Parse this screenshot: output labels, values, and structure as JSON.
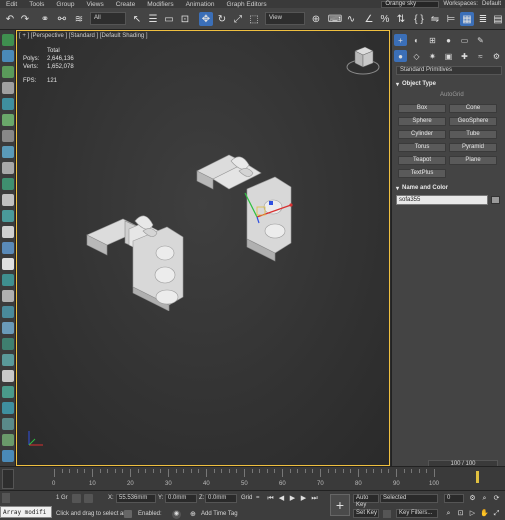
{
  "menubar": {
    "items": [
      "Edit",
      "Tools",
      "Group",
      "Views",
      "Create",
      "Modifiers",
      "Animation",
      "Graph Editors"
    ],
    "scene_name": "Orange sky",
    "workspaces_label": "Workspaces:",
    "workspace_value": "Default"
  },
  "toolbar": {
    "filter_value": "All",
    "coord_value": "View"
  },
  "viewport": {
    "label": "[ + ] [Perspective ] [Standard ] [Default Shading ]",
    "stats": {
      "total_label": "Total",
      "polys_label": "Polys:",
      "polys_value": "2,646,136",
      "verts_label": "Verts:",
      "verts_value": "1,652,078",
      "fps_label": "FPS:",
      "fps_value": "121"
    }
  },
  "command_panel": {
    "category_value": "Standard Primitives",
    "object_type_header": "Object Type",
    "autogrid_label": "AutoGrid",
    "primitives": [
      "Box",
      "Cone",
      "Sphere",
      "GeoSphere",
      "Cylinder",
      "Tube",
      "Torus",
      "Pyramid",
      "Teapot",
      "Plane",
      "TextPlus"
    ],
    "name_color_header": "Name and Color",
    "object_name": "sofa355",
    "object_color": "#9a9a9a"
  },
  "timeline": {
    "frame_display": "100 / 100",
    "ticks": [
      "0",
      "10",
      "20",
      "30",
      "40",
      "50",
      "60",
      "70",
      "80",
      "90",
      "100"
    ]
  },
  "status": {
    "selection": "1 Gr",
    "prompt": "Click and drag to select ar",
    "x_label": "X:",
    "x_value": "55.536mm",
    "y_label": "Y:",
    "y_value": "0.0mm",
    "z_label": "Z:",
    "z_value": "0.0mm",
    "grid_label": "Grid",
    "grid_value": "=",
    "enabled_label": "Enabled:",
    "add_time_tag": "Add Time Tag",
    "auto_key": "Auto Key",
    "set_key": "Set Key",
    "selected_value": "Selected",
    "key_filters": "Key Filters...",
    "frame_value": "0",
    "maxscript": "Array modifi"
  }
}
